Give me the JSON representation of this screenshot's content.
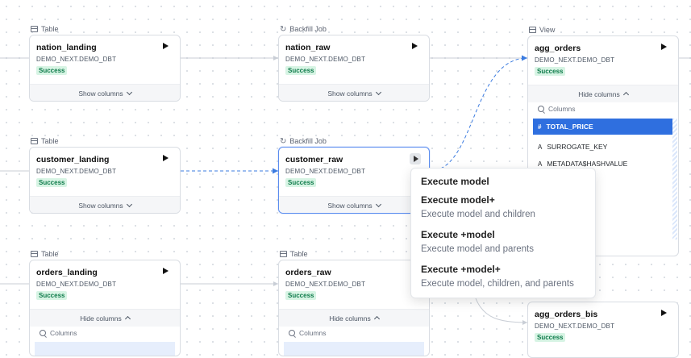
{
  "nodes": {
    "nation_landing": {
      "kind": "Table",
      "name": "nation_landing",
      "schema": "DEMO_NEXT.DEMO_DBT",
      "status": "Success",
      "columns_toggle": "Show columns"
    },
    "nation_raw": {
      "kind": "Backfill Job",
      "name": "nation_raw",
      "schema": "DEMO_NEXT.DEMO_DBT",
      "status": "Success",
      "columns_toggle": "Show columns"
    },
    "agg_orders": {
      "kind": "View",
      "name": "agg_orders",
      "schema": "DEMO_NEXT.DEMO_DBT",
      "status": "Success",
      "columns_toggle": "Hide columns",
      "search_placeholder": "Columns",
      "columns": [
        {
          "type": "#",
          "name": "TOTAL_PRICE"
        },
        {
          "type": "A",
          "name": "SURROGATE_KEY"
        },
        {
          "type": "A",
          "name": "METADATA$HASHVALUE"
        }
      ]
    },
    "customer_landing": {
      "kind": "Table",
      "name": "customer_landing",
      "schema": "DEMO_NEXT.DEMO_DBT",
      "status": "Success",
      "columns_toggle": "Show columns"
    },
    "customer_raw": {
      "kind": "Backfill Job",
      "name": "customer_raw",
      "schema": "DEMO_NEXT.DEMO_DBT",
      "status": "Success",
      "columns_toggle": "Show columns"
    },
    "orders_landing": {
      "kind": "Table",
      "name": "orders_landing",
      "schema": "DEMO_NEXT.DEMO_DBT",
      "status": "Success",
      "columns_toggle": "Hide columns",
      "search_placeholder": "Columns"
    },
    "orders_raw": {
      "kind": "Table",
      "name": "orders_raw",
      "schema": "DEMO_NEXT.DEMO_DBT",
      "status": "Success",
      "columns_toggle": "Hide columns",
      "search_placeholder": "Columns"
    },
    "agg_orders_bis": {
      "name": "agg_orders_bis",
      "schema": "DEMO_NEXT.DEMO_DBT",
      "status": "Success"
    }
  },
  "execute_menu": {
    "items": [
      {
        "title": "Execute model",
        "subtitle": ""
      },
      {
        "title": "Execute model+",
        "subtitle": "Execute model and children"
      },
      {
        "title": "Execute +model",
        "subtitle": "Execute model and parents"
      },
      {
        "title": "Execute +model+",
        "subtitle": "Execute model, children, and parents"
      }
    ]
  },
  "colors": {
    "accent": "#2f6fdf",
    "success_text": "#0f7b4b",
    "success_bg": "#d7f4e4",
    "edge": "#c9ced6",
    "active_edge": "#3b7be0"
  }
}
